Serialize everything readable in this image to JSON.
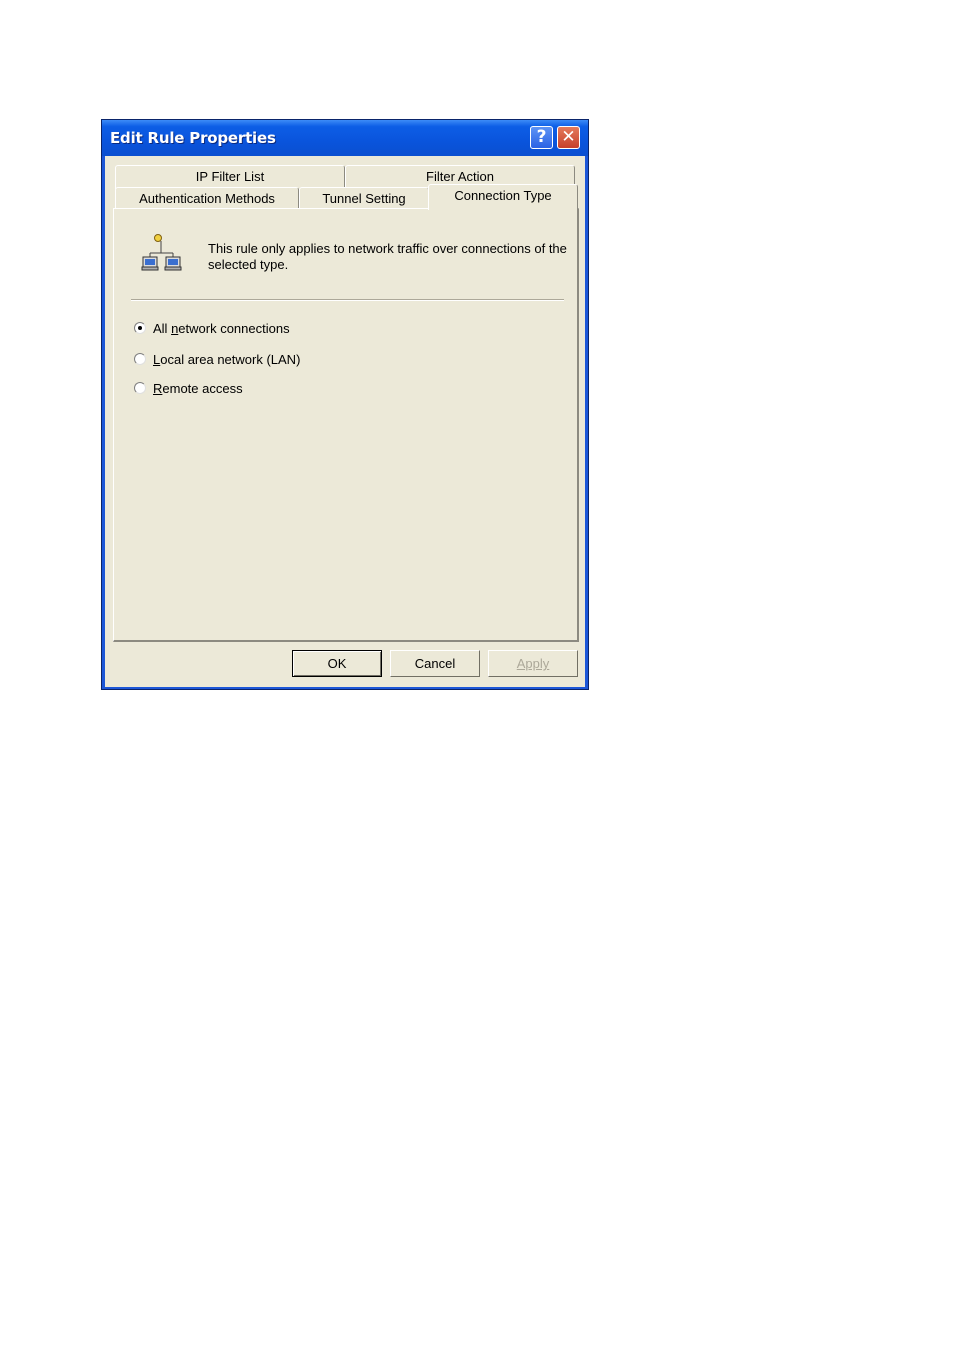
{
  "window": {
    "title": "Edit Rule Properties",
    "help_glyph": "?",
    "close_glyph": "✕"
  },
  "tabs_back": [
    {
      "label": "IP Filter List"
    },
    {
      "label": "Filter Action"
    }
  ],
  "tabs_front": [
    {
      "label": "Authentication Methods"
    },
    {
      "label": "Tunnel Setting"
    },
    {
      "label": "Connection Type",
      "active": true
    }
  ],
  "panel": {
    "icon": "network-connection-icon",
    "description": "This rule only applies to network traffic over connections of the selected type.",
    "options": [
      {
        "label_pre": "All ",
        "mnemonic": "n",
        "label_post": "etwork connections",
        "checked": true
      },
      {
        "label_pre": "",
        "mnemonic": "L",
        "label_post": "ocal area network (LAN)",
        "checked": false
      },
      {
        "label_pre": "",
        "mnemonic": "R",
        "label_post": "emote access",
        "checked": false
      }
    ]
  },
  "buttons": {
    "ok": "OK",
    "cancel": "Cancel",
    "apply": "Apply",
    "apply_enabled": false
  }
}
